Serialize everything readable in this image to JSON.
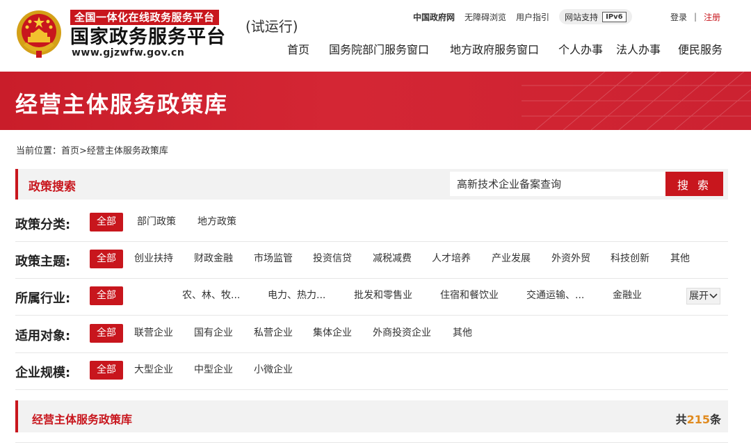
{
  "header": {
    "brand_small": "全国一体化在线政务服务平台",
    "brand_name": "国家政务服务平台",
    "brand_url": "www.gjzwfw.gov.cn",
    "trial_label": "(试运行)",
    "toplinks": [
      "中国政府网",
      "无障碍浏览",
      "用户指引"
    ],
    "ipv6_text": "网站支持",
    "ipv6_badge": "IPv6",
    "login": "登录",
    "separator": "|",
    "register": "注册",
    "nav": [
      "首页",
      "国务院部门服务窗口",
      "地方政府服务窗口",
      "个人办事",
      "法人办事",
      "便民服务"
    ]
  },
  "banner": {
    "title": "经营主体服务政策库"
  },
  "breadcrumb": "当前位置：首页>经营主体服务政策库",
  "search": {
    "title": "政策搜索",
    "query": "高新技术企业备案查询",
    "button": "搜 索"
  },
  "filters": [
    {
      "label": "政策分类:",
      "options": [
        "全部",
        "部门政策",
        "地方政策"
      ]
    },
    {
      "label": "政策主题:",
      "options": [
        "全部",
        "创业扶持",
        "财政金融",
        "市场监管",
        "投资信贷",
        "减税减费",
        "人才培养",
        "产业发展",
        "外资外贸",
        "科技创新",
        "其他"
      ]
    },
    {
      "label": "所属行业:",
      "options": [
        "全部",
        "农、林、牧...",
        "电力、热力...",
        "批发和零售业",
        "住宿和餐饮业",
        "交通运输、...",
        "金融业"
      ],
      "expand": "展开"
    },
    {
      "label": "适用对象:",
      "options": [
        "全部",
        "联营企业",
        "国有企业",
        "私营企业",
        "集体企业",
        "外商投资企业",
        "其他"
      ]
    },
    {
      "label": "企业规模:",
      "options": [
        "全部",
        "大型企业",
        "中型企业",
        "小微企业"
      ]
    }
  ],
  "results": {
    "title": "经营主体服务政策库",
    "count_prefix": "共",
    "count": "215",
    "count_suffix": "条"
  },
  "colors": {
    "accent": "#c8161d",
    "count_highlight": "#e08a1e",
    "panel_bg": "#f2f2f2"
  },
  "icons": {
    "emblem": "national-emblem-icon",
    "expand": "chevron-down-icon"
  }
}
